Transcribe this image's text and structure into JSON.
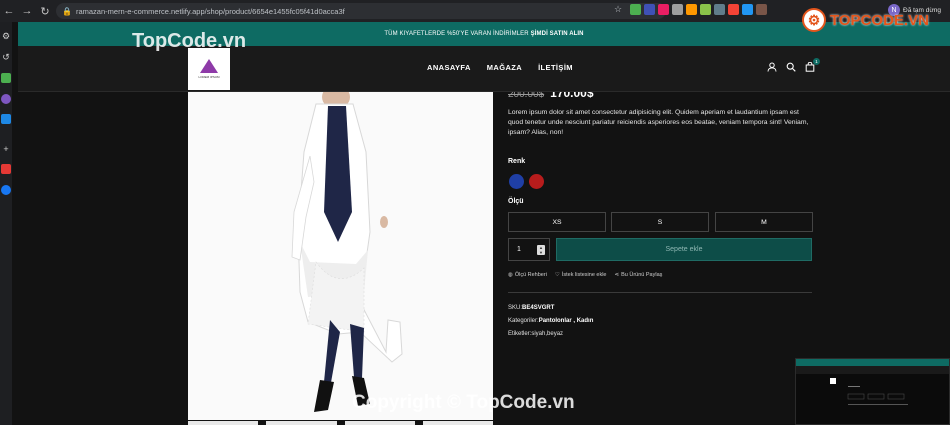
{
  "browser": {
    "url": "ramazan-mern-e-commerce.netlify.app/shop/product/6654e1455fc05f41d0acca3f",
    "profile_label": "Đã tạm dừng",
    "profile_initial": "N"
  },
  "promo_bar": {
    "text": "TÜM KIYAFETLERDE %50'YE VARAN İNDİRİMLER",
    "cta": "ŞİMDİ SATIN ALIN"
  },
  "header": {
    "logo_text": "LOREM IPSUM",
    "menu": [
      "ANASAYFA",
      "MAĞAZA",
      "İLETİŞİM"
    ],
    "cart_count": "1"
  },
  "product": {
    "old_price": "200.00$",
    "new_price": "170.00$",
    "description": "Lorem ipsum dolor sit amet consectetur adipisicing elit. Quidem aperiam et laudantium ipsam est quod tenetur unde nesciunt pariatur reiciendis asperiores eos beatae, veniam tempora sint! Veniam, ipsam? Alias, non!",
    "color_label": "Renk",
    "colors": [
      "#1f3fa6",
      "#b71c1c"
    ],
    "size_label": "Ölçü",
    "sizes": [
      "XS",
      "S",
      "M"
    ],
    "quantity": "1",
    "add_to_cart": "Sepete ekle",
    "actions": [
      "Ölçü Rehberi",
      "İstek listesine ekle",
      "Bu Ürünü Paylaş"
    ],
    "sku_label": "SKU:",
    "sku": "BE4SVGRT",
    "categories_label": "Kategoriler:",
    "categories": "Pantolonlar , Kadın",
    "tags_label": "Etiketler:",
    "tags": "siyah,beyaz"
  },
  "watermarks": {
    "top_left": "TopCode.vn",
    "bottom": "Copyright © TopCode.vn",
    "badge": "TOPCODE.VN"
  }
}
